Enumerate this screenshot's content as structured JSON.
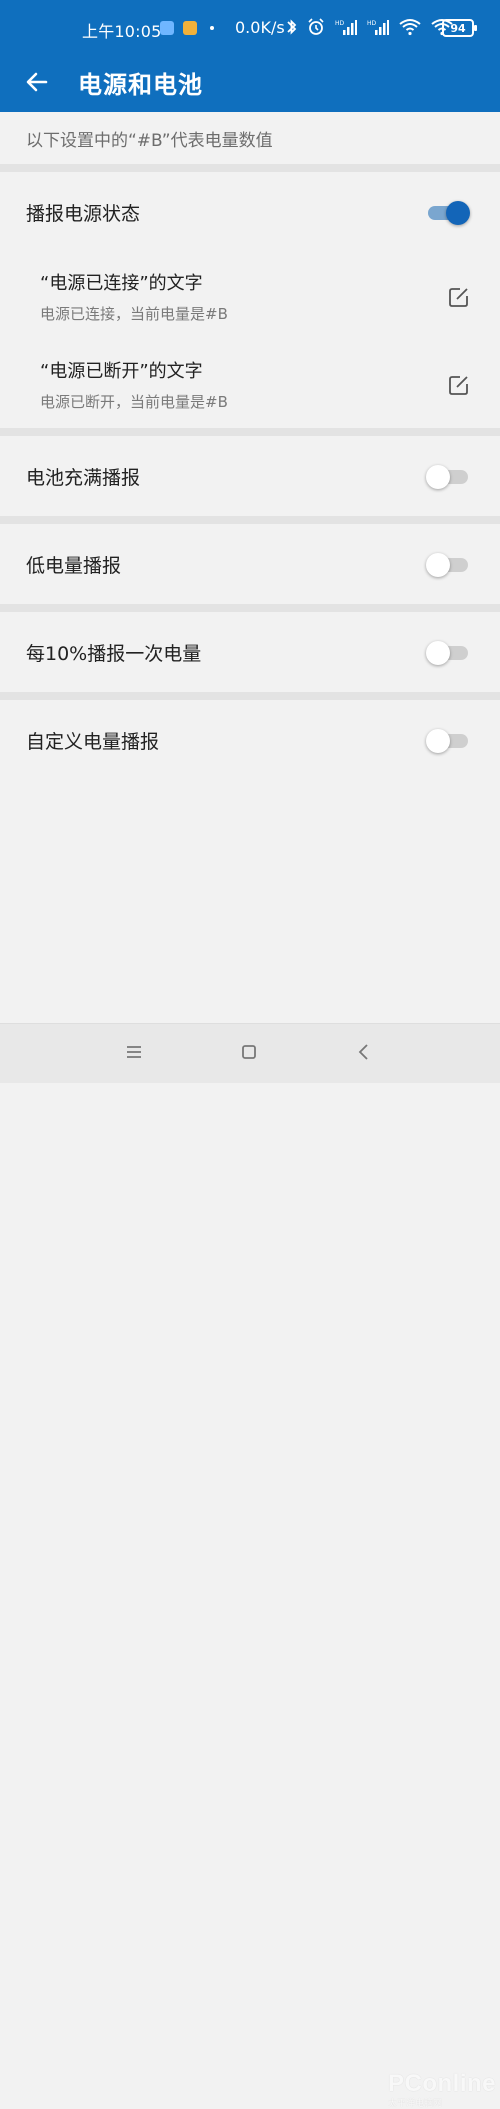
{
  "status_bar": {
    "time": "上午10:05",
    "speed": "0.0K/s",
    "battery": "94",
    "icons": [
      "bluetooth-icon",
      "alarm-icon",
      "hd-signal-icon",
      "hd-signal-icon",
      "wifi-icon",
      "wifi-icon"
    ]
  },
  "app_bar": {
    "title": "电源和电池",
    "back_icon": "arrow-left-icon"
  },
  "note": "以下设置中的“#B”代表电量数值",
  "settings": {
    "power_status": {
      "label": "播报电源状态",
      "on": true,
      "items": [
        {
          "title": "“电源已连接”的文字",
          "value": "电源已连接，当前电量是#B"
        },
        {
          "title": "“电源已断开”的文字",
          "value": "电源已断开，当前电量是#B"
        }
      ]
    },
    "battery_full": {
      "label": "电池充满播报",
      "on": false
    },
    "low_battery": {
      "label": "低电量播报",
      "on": false
    },
    "every_10": {
      "label": "每10%播报一次电量",
      "on": false
    },
    "custom": {
      "label": "自定义电量播报",
      "on": false
    }
  },
  "colors": {
    "primary": "#0f6fbe",
    "switch_on_thumb": "#1365b8",
    "switch_on_track": "#7aa6cf",
    "background": "#f2f2f2"
  },
  "watermark": {
    "main": "PConline",
    "sub": "太平洋电脑网"
  }
}
